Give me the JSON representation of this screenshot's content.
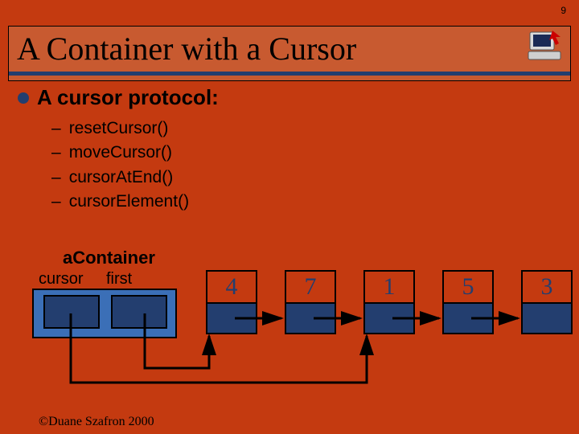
{
  "page_number": "9",
  "title": "A Container with a Cursor",
  "bullet": "A cursor protocol:",
  "protocol": [
    "resetCursor()",
    "moveCursor()",
    "cursorAtEnd()",
    "cursorElement()"
  ],
  "diagram": {
    "container_label": "aContainer",
    "slot_cursor": "cursor",
    "slot_first": "first",
    "nodes": [
      "4",
      "7",
      "1",
      "5",
      "3"
    ]
  },
  "footer": "©Duane Szafron 2000"
}
